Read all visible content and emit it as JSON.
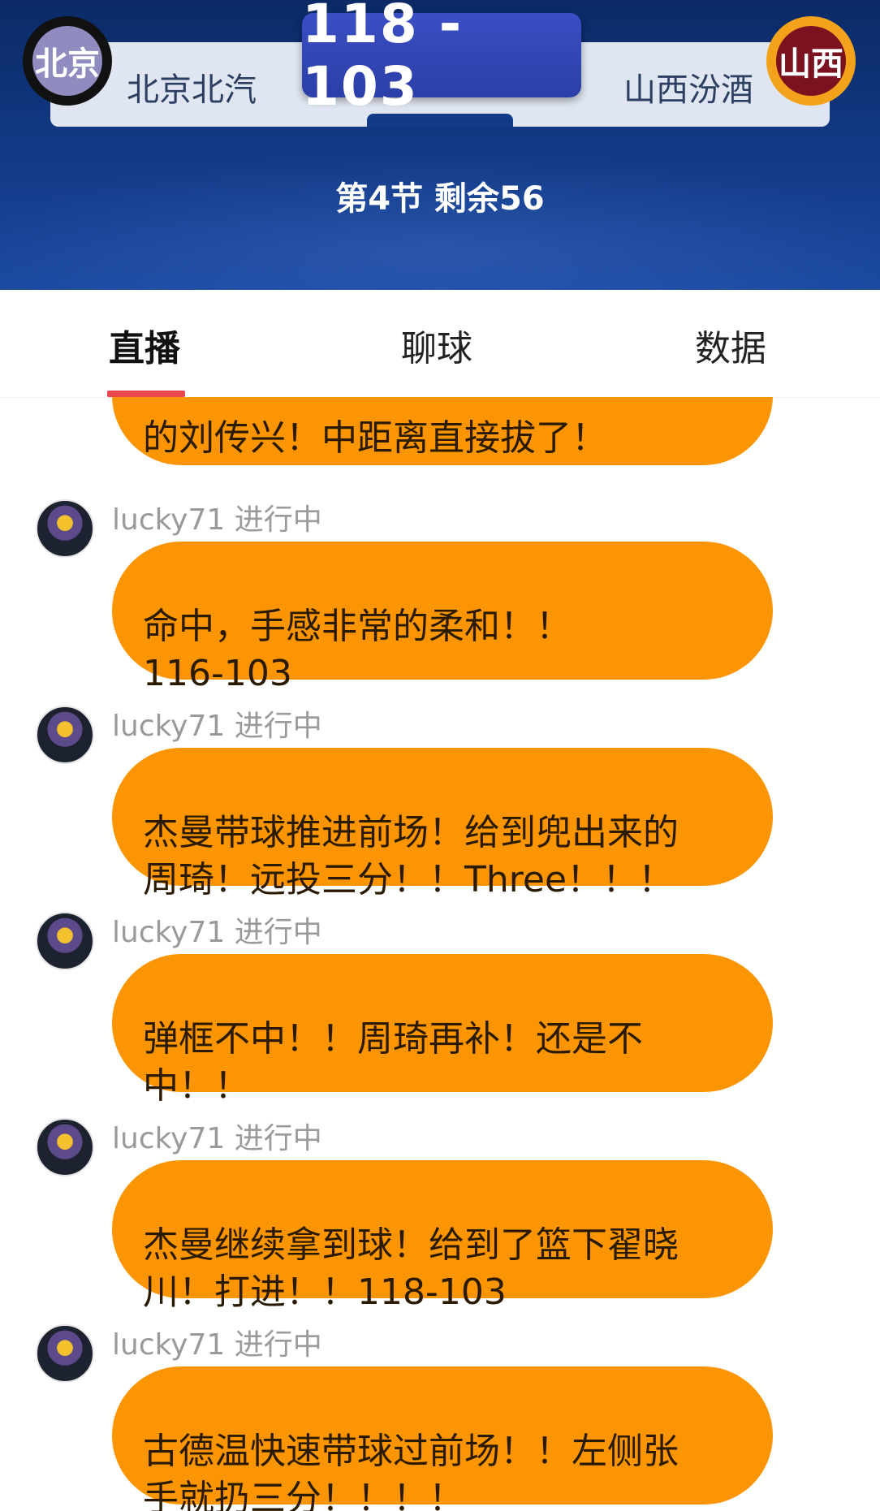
{
  "header": {
    "home": {
      "logo_text": "北京",
      "name": "北京北汽"
    },
    "away": {
      "logo_text": "山西",
      "name": "山西汾酒"
    },
    "score": "118 - 103",
    "period": "第4节 剩余56"
  },
  "tabs": [
    {
      "label": "直播",
      "active": true
    },
    {
      "label": "聊球",
      "active": false
    },
    {
      "label": "数据",
      "active": false
    }
  ],
  "feed": {
    "first_partial": "的刘传兴！中距离直接拔了！",
    "items": [
      {
        "user": "lucky71 进行中",
        "text": "命中，手感非常的柔和！！\n116-103"
      },
      {
        "user": "lucky71 进行中",
        "text": "杰曼带球推进前场！给到兜出来的\n周琦！远投三分！！Three！！！"
      },
      {
        "user": "lucky71 进行中",
        "text": "弹框不中！！周琦再补！还是不\n中！！"
      },
      {
        "user": "lucky71 进行中",
        "text": "杰曼继续拿到球！给到了篮下翟晓\n川！打进！！118-103"
      },
      {
        "user": "lucky71 进行中",
        "text": "古德温快速带球过前场！！左侧张\n手就扔三分！！！！"
      }
    ]
  },
  "colors": {
    "header_bg": "#123a86",
    "score_box": "#2c3ea8",
    "bubble": "#fb9504",
    "tab_indicator": "#e8484e",
    "away_logo_ring": "#f3a21b"
  }
}
